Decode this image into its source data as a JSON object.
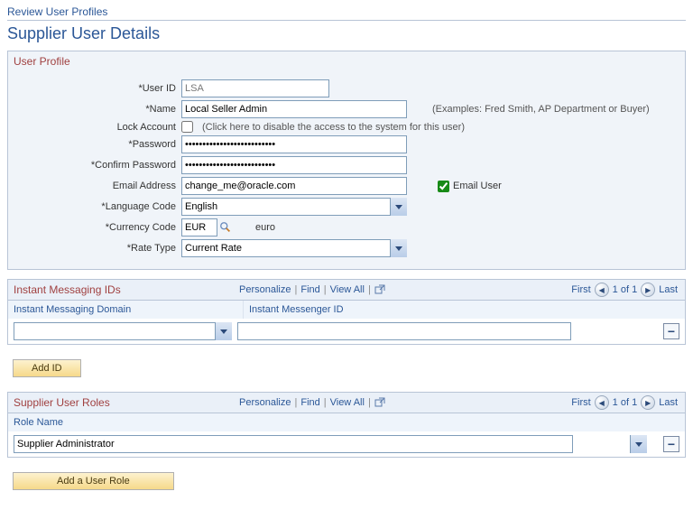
{
  "breadcrumb": "Review User Profiles",
  "page_title": "Supplier User Details",
  "group_title": "User Profile",
  "labels": {
    "user_id": "*User ID",
    "name": "*Name",
    "lock": "Lock Account",
    "password": "*Password",
    "confirm": "*Confirm Password",
    "email": "Email Address",
    "lang": "*Language Code",
    "curr": "*Currency Code",
    "rate": "*Rate Type"
  },
  "values": {
    "user_id": "LSA",
    "name": "Local Seller Admin",
    "name_hint": "(Examples: Fred Smith, AP Department or Buyer)",
    "lock_hint": "(Click here to disable the access to the system for this user)",
    "password": "••••••••••••••••••••••••••",
    "confirm": "••••••••••••••••••••••••••",
    "email": "change_me@oracle.com",
    "email_user_label": "Email User",
    "lang": "English",
    "curr": "EUR",
    "curr_name": "euro",
    "rate": "Current Rate"
  },
  "grid_tools": {
    "personalize": "Personalize",
    "find": "Find",
    "viewall": "View All",
    "first": "First",
    "count": "1 of 1",
    "last": "Last"
  },
  "im_grid": {
    "title": "Instant Messaging IDs",
    "col1": "Instant Messaging Domain",
    "col2": "Instant Messenger ID",
    "domain": "",
    "id": ""
  },
  "roles_grid": {
    "title": "Supplier User Roles",
    "col1": "Role Name",
    "role": "Supplier Administrator"
  },
  "buttons": {
    "add_id": "Add ID",
    "add_role": "Add a User Role"
  }
}
